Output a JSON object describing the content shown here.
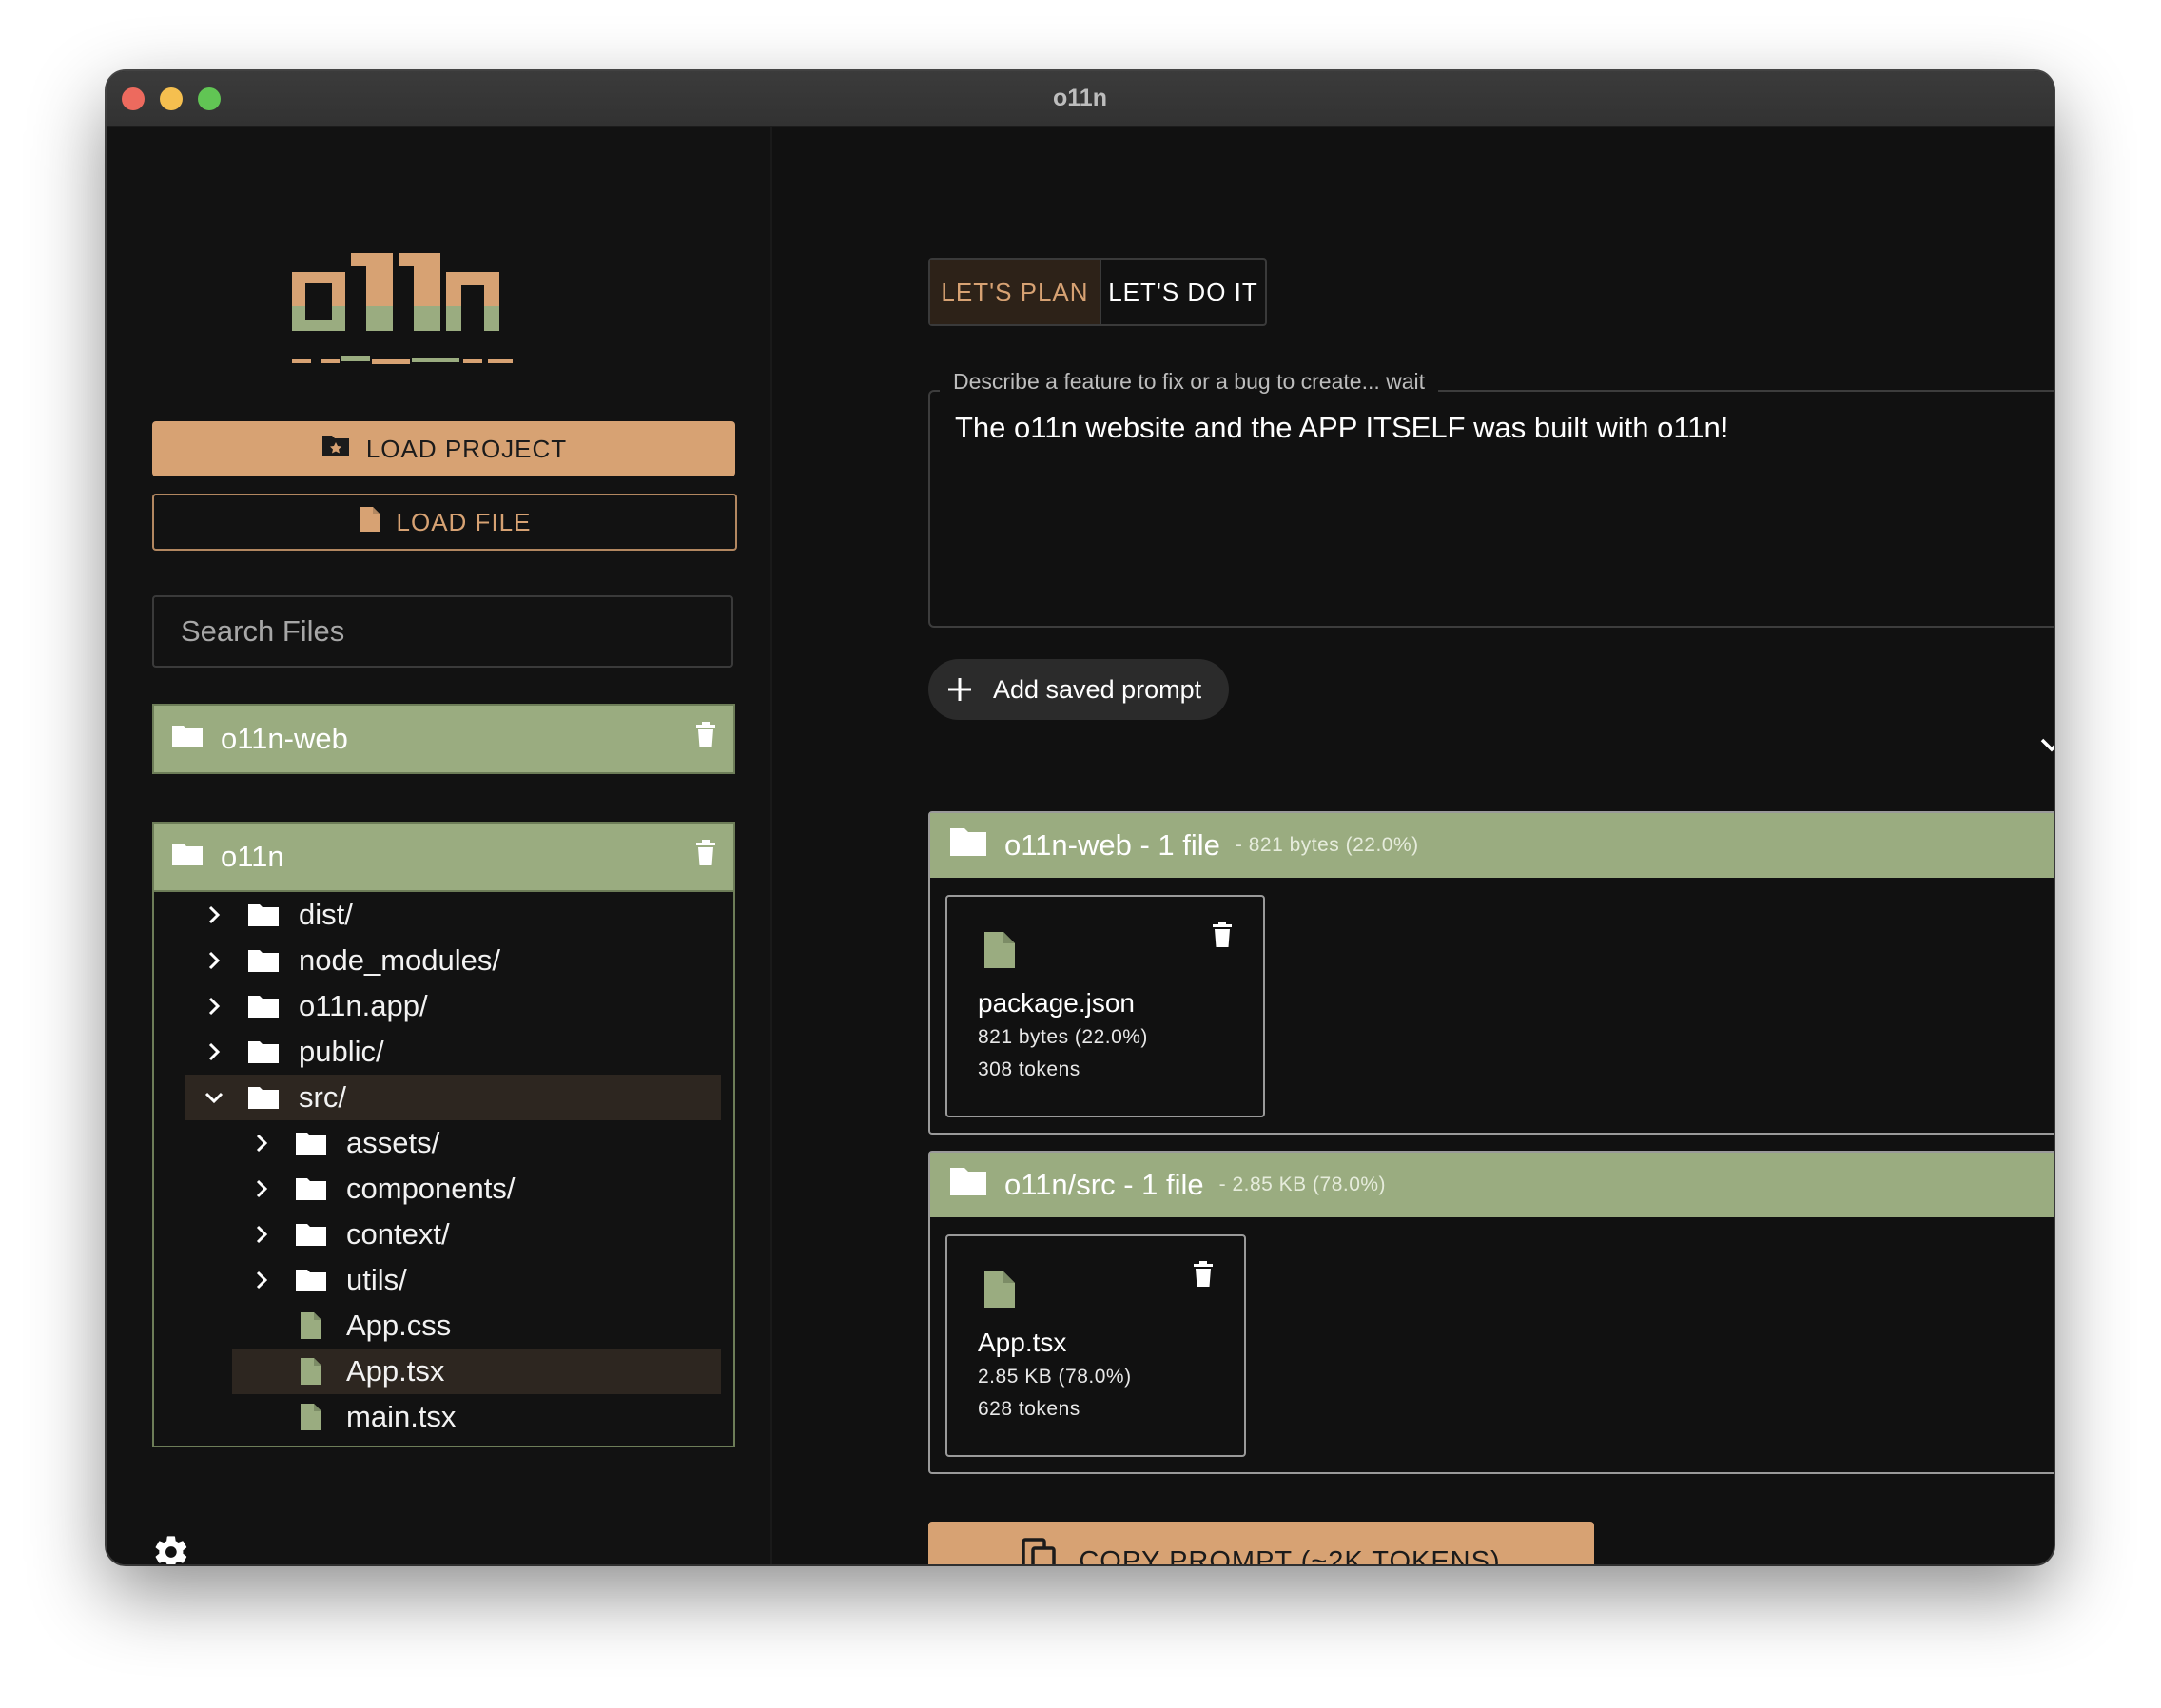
{
  "window": {
    "title": "o11n"
  },
  "sidebar": {
    "load_project_label": "LOAD PROJECT",
    "load_file_label": "LOAD FILE",
    "search_placeholder": "Search Files",
    "projects": [
      {
        "name": "o11n-web",
        "expanded": false
      },
      {
        "name": "o11n",
        "expanded": true
      }
    ],
    "tree": [
      {
        "label": "dist/",
        "type": "folder",
        "expanded": false
      },
      {
        "label": "node_modules/",
        "type": "folder",
        "expanded": false
      },
      {
        "label": "o11n.app/",
        "type": "folder",
        "expanded": false
      },
      {
        "label": "public/",
        "type": "folder",
        "expanded": false
      },
      {
        "label": "src/",
        "type": "folder",
        "expanded": true,
        "selected": true
      },
      {
        "label": "assets/",
        "type": "folder",
        "expanded": false
      },
      {
        "label": "components/",
        "type": "folder",
        "expanded": false
      },
      {
        "label": "context/",
        "type": "folder",
        "expanded": false
      },
      {
        "label": "utils/",
        "type": "folder",
        "expanded": false
      },
      {
        "label": "App.css",
        "type": "file"
      },
      {
        "label": "App.tsx",
        "type": "file",
        "selected": true
      },
      {
        "label": "main.tsx",
        "type": "file"
      }
    ]
  },
  "main": {
    "tabs": [
      {
        "label": "LET'S PLAN",
        "active": true
      },
      {
        "label": "LET'S DO IT",
        "active": false
      }
    ],
    "description": {
      "legend": "Describe a feature to fix or a bug to create... wait",
      "value": "The o11n website and the APP ITSELF was built with o11n!"
    },
    "add_saved_prompt_label": "Add saved prompt",
    "groups": [
      {
        "title": "o11n-web - 1 file",
        "meta": "- 821 bytes (22.0%)",
        "files": [
          {
            "name": "package.json",
            "size": "821 bytes (22.0%)",
            "tokens": "308 tokens"
          }
        ]
      },
      {
        "title": "o11n/src - 1 file",
        "meta": "- 2.85 KB (78.0%)",
        "files": [
          {
            "name": "App.tsx",
            "size": "2.85 KB (78.0%)",
            "tokens": "628 tokens"
          }
        ]
      }
    ],
    "copy_prompt_label": "COPY PROMPT (~2K TOKENS)"
  },
  "colors": {
    "accent": "#d7a273",
    "project_green": "#9aac80",
    "background": "#111111",
    "selected_row": "#2d2620"
  },
  "icons": [
    "folder-icon",
    "file-icon",
    "trash-icon",
    "chevron-right-icon",
    "chevron-down-icon",
    "plus-icon",
    "copy-icon",
    "gear-icon",
    "folder-star-icon"
  ]
}
